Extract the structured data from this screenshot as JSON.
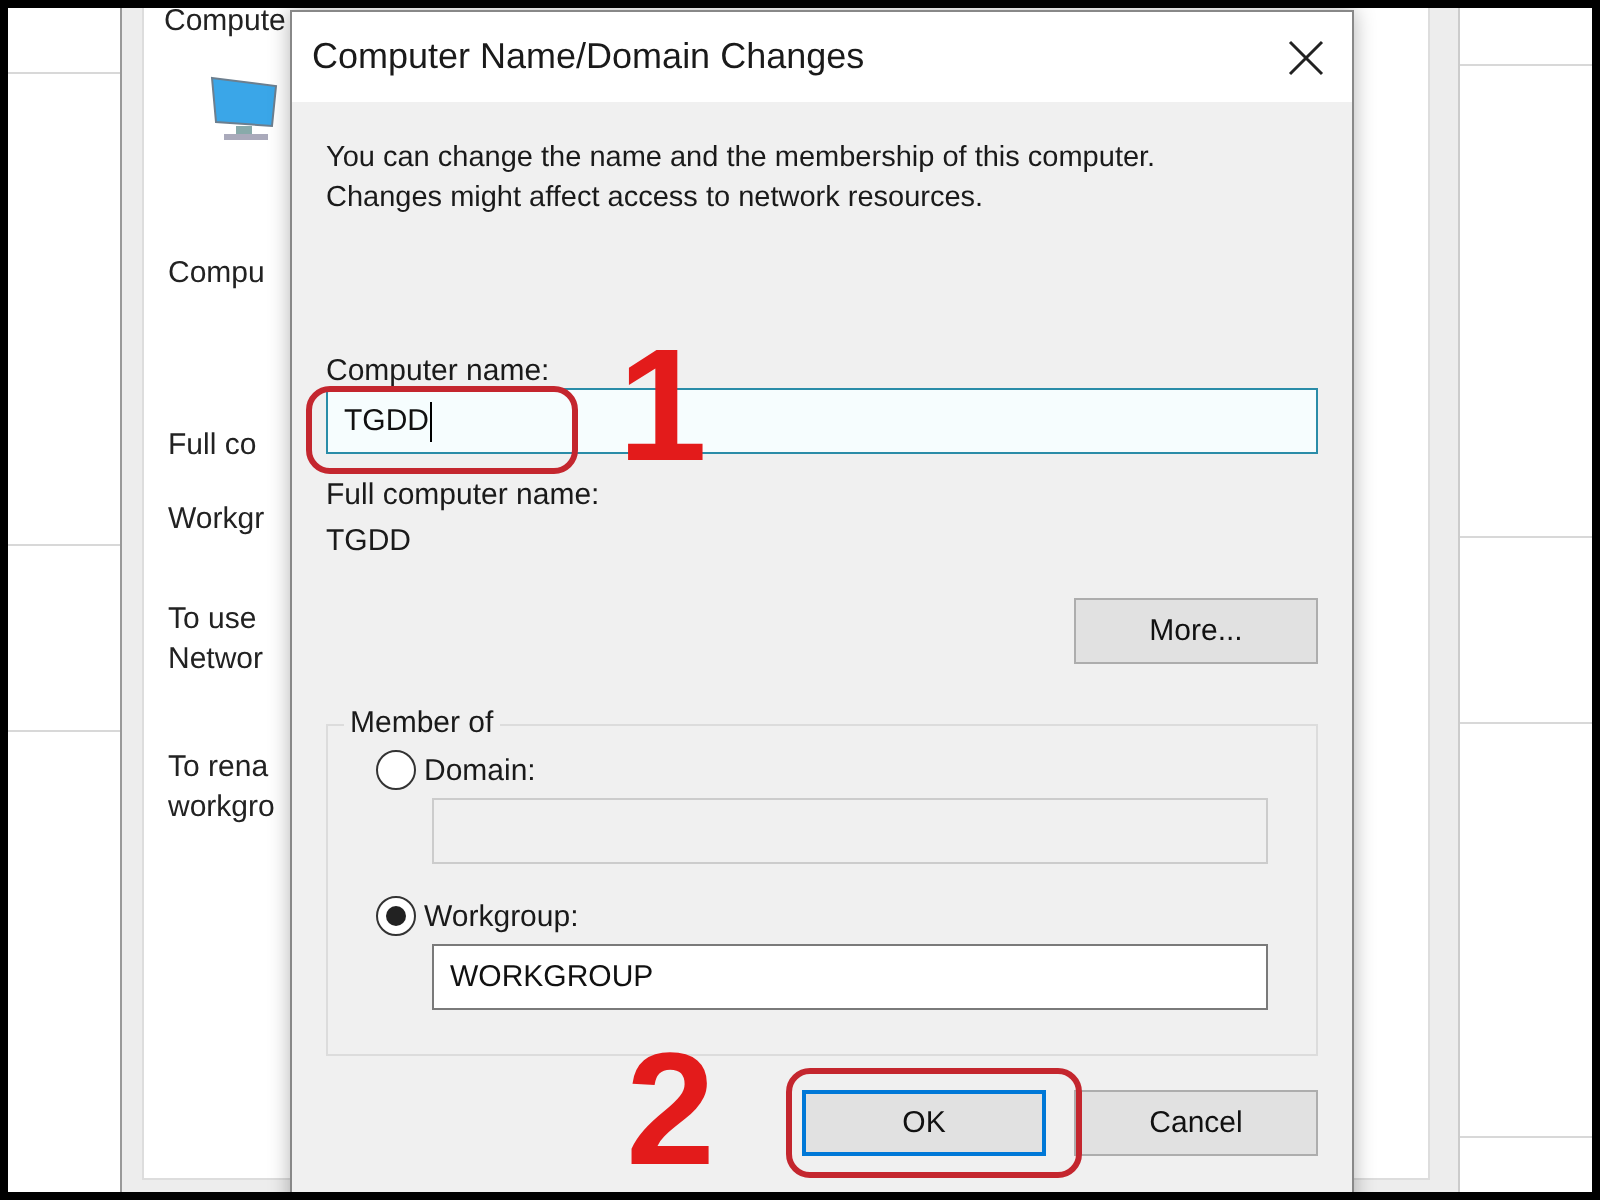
{
  "background_window": {
    "title": "Compute",
    "items": [
      {
        "lines": [
          "Compu"
        ]
      },
      {
        "lines": [
          "Full co"
        ]
      },
      {
        "lines": [
          "Workgr"
        ]
      },
      {
        "lines": [
          "To use",
          "Networ"
        ]
      },
      {
        "lines": [
          "To rena",
          "workgro"
        ]
      }
    ]
  },
  "dialog": {
    "title": "Computer Name/Domain Changes",
    "description": [
      "You can change the name and the membership of this computer.",
      "Changes might affect access to network resources."
    ],
    "computer_name": {
      "label": "Computer name:",
      "value": "TGDD"
    },
    "full_computer_name": {
      "label": "Full computer name:",
      "value": "TGDD"
    },
    "more_button": "More...",
    "member_of": {
      "label": "Member of",
      "options": [
        {
          "label": "Domain:",
          "selected": false,
          "field": {
            "disabled": true
          }
        },
        {
          "label": "Workgroup:",
          "selected": true,
          "field": {
            "value": "WORKGROUP",
            "disabled": false
          }
        }
      ]
    },
    "buttons": [
      {
        "label": "OK",
        "default": true
      },
      {
        "label": "Cancel",
        "default": false
      }
    ]
  },
  "annotations": [
    {
      "number": "1"
    },
    {
      "number": "2"
    }
  ]
}
